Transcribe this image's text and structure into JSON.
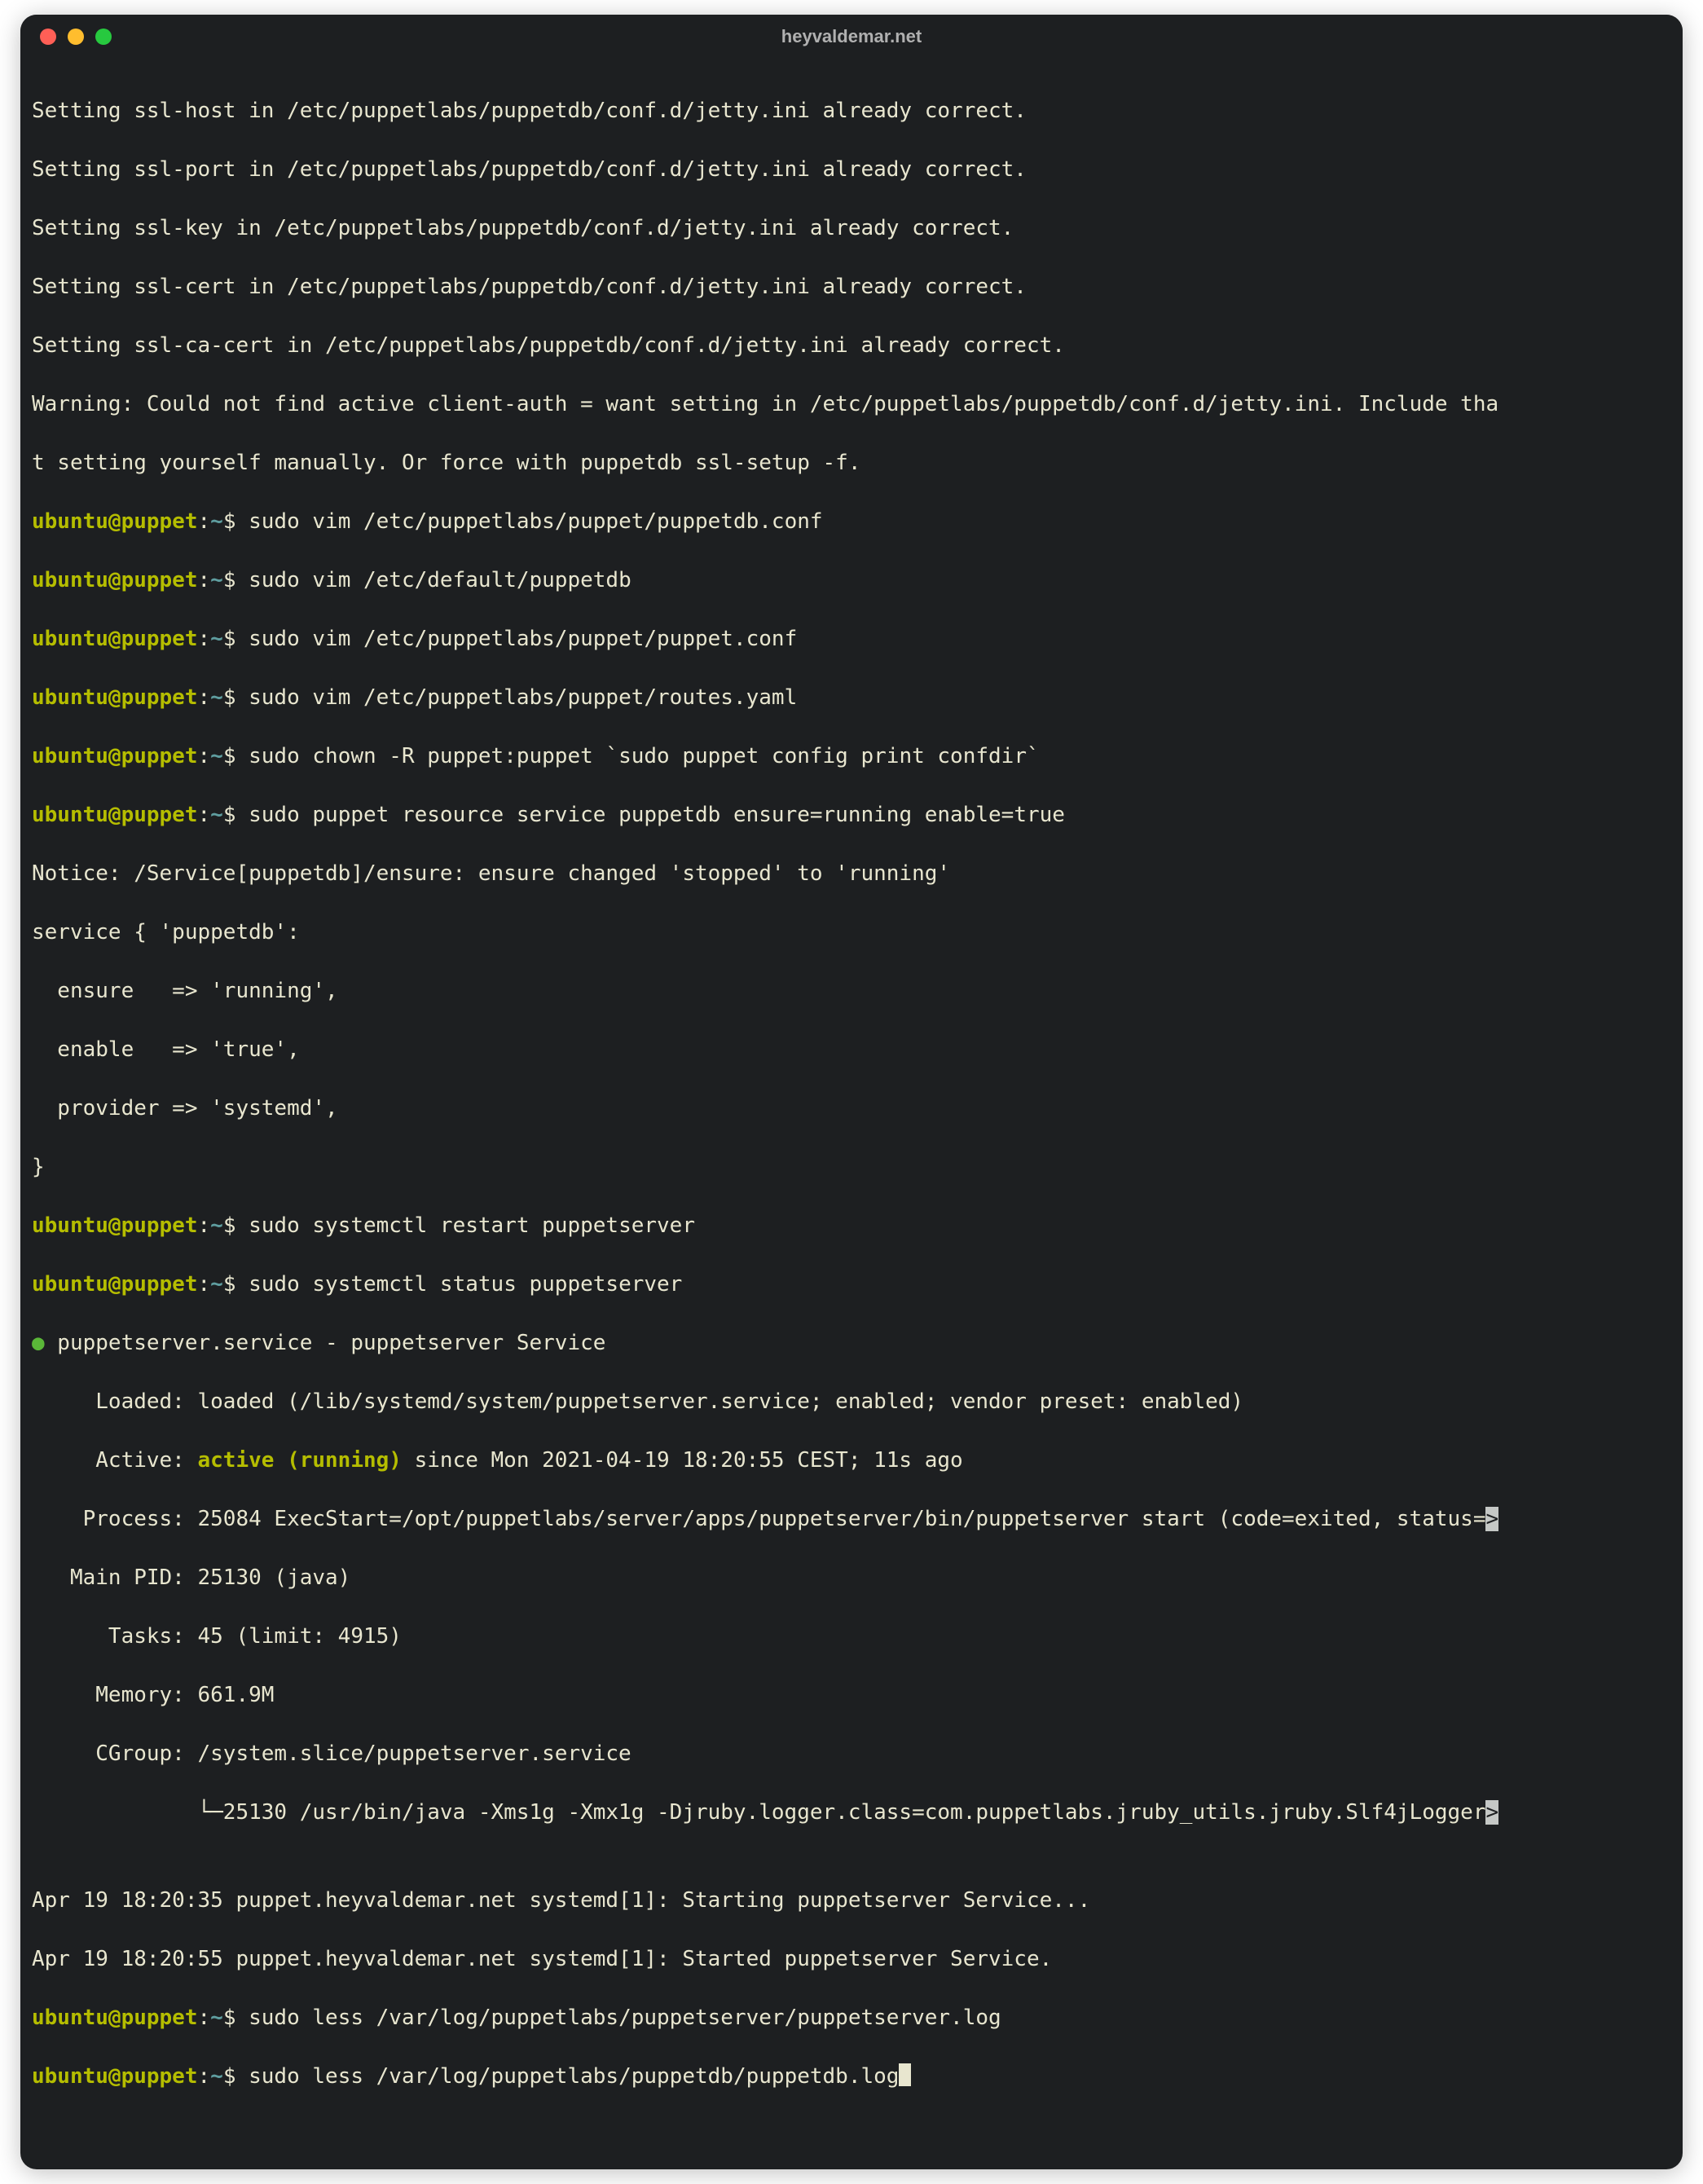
{
  "window": {
    "title": "heyvaldemar.net"
  },
  "prompt": {
    "user_host": "ubuntu@puppet",
    "colon": ":",
    "path": "~",
    "symbol": "$ "
  },
  "lines": {
    "l01": "Setting ssl-host in /etc/puppetlabs/puppetdb/conf.d/jetty.ini already correct.",
    "l02": "Setting ssl-port in /etc/puppetlabs/puppetdb/conf.d/jetty.ini already correct.",
    "l03": "Setting ssl-key in /etc/puppetlabs/puppetdb/conf.d/jetty.ini already correct.",
    "l04": "Setting ssl-cert in /etc/puppetlabs/puppetdb/conf.d/jetty.ini already correct.",
    "l05": "Setting ssl-ca-cert in /etc/puppetlabs/puppetdb/conf.d/jetty.ini already correct.",
    "l06": "Warning: Could not find active client-auth = want setting in /etc/puppetlabs/puppetdb/conf.d/jetty.ini. Include tha",
    "l07": "t setting yourself manually. Or force with puppetdb ssl-setup -f.",
    "c01": "sudo vim /etc/puppetlabs/puppet/puppetdb.conf",
    "c02": "sudo vim /etc/default/puppetdb",
    "c03": "sudo vim /etc/puppetlabs/puppet/puppet.conf",
    "c04": "sudo vim /etc/puppetlabs/puppet/routes.yaml",
    "c05": "sudo chown -R puppet:puppet `sudo puppet config print confdir`",
    "c06": "sudo puppet resource service puppetdb ensure=running enable=true",
    "l08": "Notice: /Service[puppetdb]/ensure: ensure changed 'stopped' to 'running'",
    "l09": "service { 'puppetdb':",
    "l10": "  ensure   => 'running',",
    "l11": "  enable   => 'true',",
    "l12": "  provider => 'systemd',",
    "l13": "}",
    "c07": "sudo systemctl restart puppetserver",
    "c08": "sudo systemctl status puppetserver",
    "svc_dot": "●",
    "svc_name": " puppetserver.service - puppetserver Service",
    "svc_loaded": "     Loaded: loaded (/lib/systemd/system/puppetserver.service; enabled; vendor preset: enabled)",
    "svc_active_label": "     Active: ",
    "svc_active_value": "active (running)",
    "svc_active_rest": " since Mon 2021-04-19 18:20:55 CEST; 11s ago",
    "svc_process_a": "    Process: 25084 ExecStart=/opt/puppetlabs/server/apps/puppetserver/bin/puppetserver start (code=exited, status=",
    "svc_process_arrow": ">",
    "svc_mainpid": "   Main PID: 25130 (java)",
    "svc_tasks": "      Tasks: 45 (limit: 4915)",
    "svc_mem": "     Memory: 661.9M",
    "svc_cgroup": "     CGroup: /system.slice/puppetserver.service",
    "svc_cgroup2a": "             └─25130 /usr/bin/java -Xms1g -Xmx1g -Djruby.logger.class=com.puppetlabs.jruby_utils.jruby.Slf4jLogger",
    "svc_cgroup2_arrow": ">",
    "blank": "",
    "log1": "Apr 19 18:20:35 puppet.heyvaldemar.net systemd[1]: Starting puppetserver Service...",
    "log2": "Apr 19 18:20:55 puppet.heyvaldemar.net systemd[1]: Started puppetserver Service.",
    "c09": "sudo less /var/log/puppetlabs/puppetserver/puppetserver.log",
    "c10": "sudo less /var/log/puppetlabs/puppetdb/puppetdb.log"
  }
}
